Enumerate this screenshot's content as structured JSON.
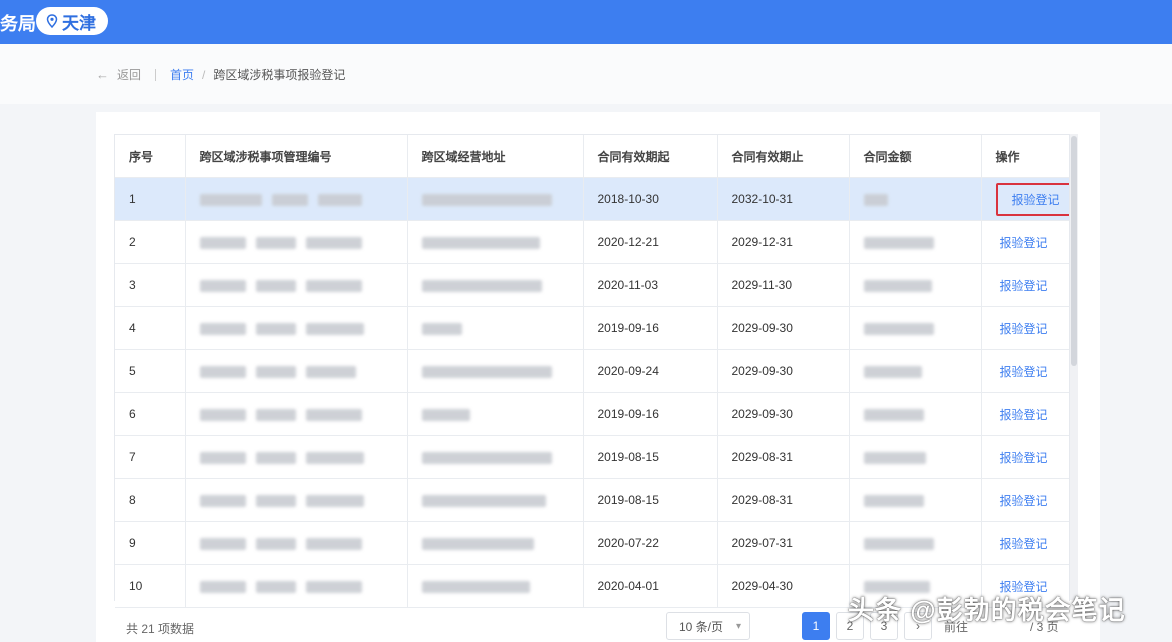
{
  "topbar": {
    "brand_fragment": "务局",
    "city": "天津"
  },
  "breadcrumb": {
    "back": "返回",
    "home": "首页",
    "current": "跨区域涉税事项报验登记"
  },
  "table": {
    "headers": [
      "序号",
      "跨区域涉税事项管理编号",
      "跨区域经营地址",
      "合同有效期起",
      "合同有效期止",
      "合同金额",
      "操作"
    ],
    "rows": [
      {
        "no": "1",
        "start": "2018-10-30",
        "end": "2032-10-31",
        "action": "报验登记"
      },
      {
        "no": "2",
        "start": "2020-12-21",
        "end": "2029-12-31",
        "action": "报验登记"
      },
      {
        "no": "3",
        "start": "2020-11-03",
        "end": "2029-11-30",
        "action": "报验登记"
      },
      {
        "no": "4",
        "start": "2019-09-16",
        "end": "2029-09-30",
        "action": "报验登记"
      },
      {
        "no": "5",
        "start": "2020-09-24",
        "end": "2029-09-30",
        "action": "报验登记"
      },
      {
        "no": "6",
        "start": "2019-09-16",
        "end": "2029-09-30",
        "action": "报验登记"
      },
      {
        "no": "7",
        "start": "2019-08-15",
        "end": "2029-08-31",
        "action": "报验登记"
      },
      {
        "no": "8",
        "start": "2019-08-15",
        "end": "2029-08-31",
        "action": "报验登记"
      },
      {
        "no": "9",
        "start": "2020-07-22",
        "end": "2029-07-31",
        "action": "报验登记"
      },
      {
        "no": "10",
        "start": "2020-04-01",
        "end": "2029-04-30",
        "action": "报验登记"
      }
    ]
  },
  "pagination": {
    "total": "共 21 项数据",
    "page_size": "10 条/页",
    "pages": [
      "1",
      "2",
      "3"
    ],
    "next": "›",
    "jump_label": "前往",
    "total_pages": "/ 3 页"
  },
  "watermark": "头条 @彭勃的税会笔记",
  "colors": {
    "primary": "#3d7ef0",
    "selected_row": "#dce9fb",
    "highlight_box": "#d9333f"
  }
}
